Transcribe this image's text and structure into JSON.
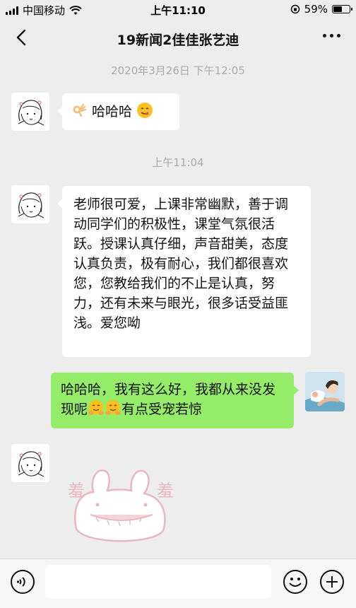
{
  "status_bar": {
    "carrier": "中国移动",
    "time": "上午11:10",
    "battery": "59%",
    "battery_level": 0.59
  },
  "header": {
    "title": "19新闻2佳佳张艺迪"
  },
  "timestamps": {
    "first": "2020年3月26日 下午12:05",
    "second": "上午11:04"
  },
  "messages": [
    {
      "sender": "contact",
      "text": "哈哈哈",
      "emoji_before": "ok-hand-emoji",
      "emoji_after": "yum-face-emoji"
    },
    {
      "sender": "contact",
      "text": "老师很可爱，上课非常幽默，善于调动同学们的积极性，课堂气氛很活跃。授课认真仔细，声音甜美，态度认真负责，极有耐心，我们都很喜欢您，您教给我们的不止是认真，努力，还有未来与眼光，很多话受益匪浅。爱您呦"
    },
    {
      "sender": "me",
      "text_a": "哈哈哈，我有这么好，我都从来没发现呢",
      "text_b": "有点受宠若惊",
      "emojis": [
        "hugging-face-emoji",
        "hugging-face-emoji"
      ]
    },
    {
      "sender": "contact",
      "type": "sticker",
      "sticker": "shy-bunny-sticker",
      "sticker_text": [
        "羞",
        "羞"
      ]
    }
  ],
  "input_bar": {
    "voice_icon": "voice-icon",
    "emoji_icon": "emoji-icon",
    "plus_icon": "plus-icon",
    "placeholder": ""
  },
  "colors": {
    "background": "#ededed",
    "my_bubble": "#95ec69",
    "their_bubble": "#ffffff",
    "timestamp_text": "#aaaaaa"
  }
}
